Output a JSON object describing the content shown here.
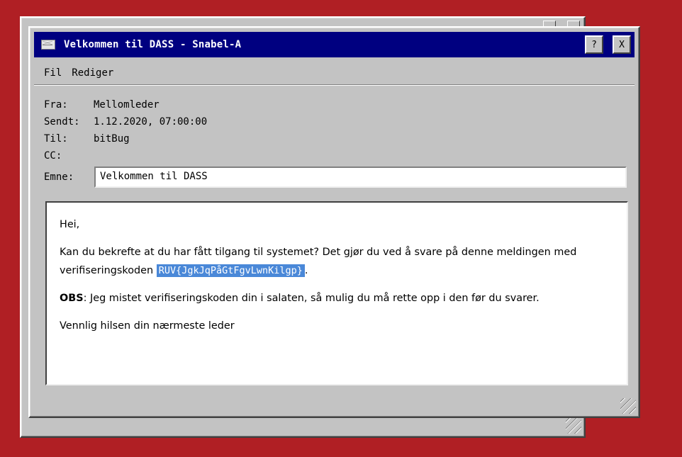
{
  "window": {
    "title": "Velkommen til DASS - Snabel-A",
    "help_label": "?",
    "close_label": "X"
  },
  "menu": {
    "items": [
      {
        "label": "Fil"
      },
      {
        "label": "Rediger"
      }
    ]
  },
  "headers": {
    "from_label": "Fra:",
    "from_value": "Mellomleder",
    "sent_label": "Sendt:",
    "sent_value": "1.12.2020, 07:00:00",
    "to_label": "Til:",
    "to_value": "bitBug",
    "cc_label": "CC:",
    "cc_value": "",
    "subject_label": "Emne:",
    "subject_value": "Velkommen til DASS"
  },
  "message": {
    "greeting": "Hei,",
    "paragraph1_before": "Kan du bekrefte at du har fått tilgang til systemet? Det gjør du ved å svare på denne meldingen med verifiseringskoden ",
    "verification_code": "RUV{JgkJqPåGtFgvLwnKilgp}",
    "paragraph1_after": ".",
    "obs_label": "OBS",
    "obs_text": ": Jeg mistet verifiseringskoden din i salaten, så mulig du må rette opp i den før du svarer.",
    "signoff": "Vennlig hilsen din nærmeste leder"
  },
  "colors": {
    "desktop": "#b01f24",
    "titlebar": "#000080",
    "window": "#c3c3c3",
    "selection": "#4a88d8"
  },
  "icons": {
    "title_icon": "envelope-icon",
    "resize": "resize-grip-icon"
  }
}
